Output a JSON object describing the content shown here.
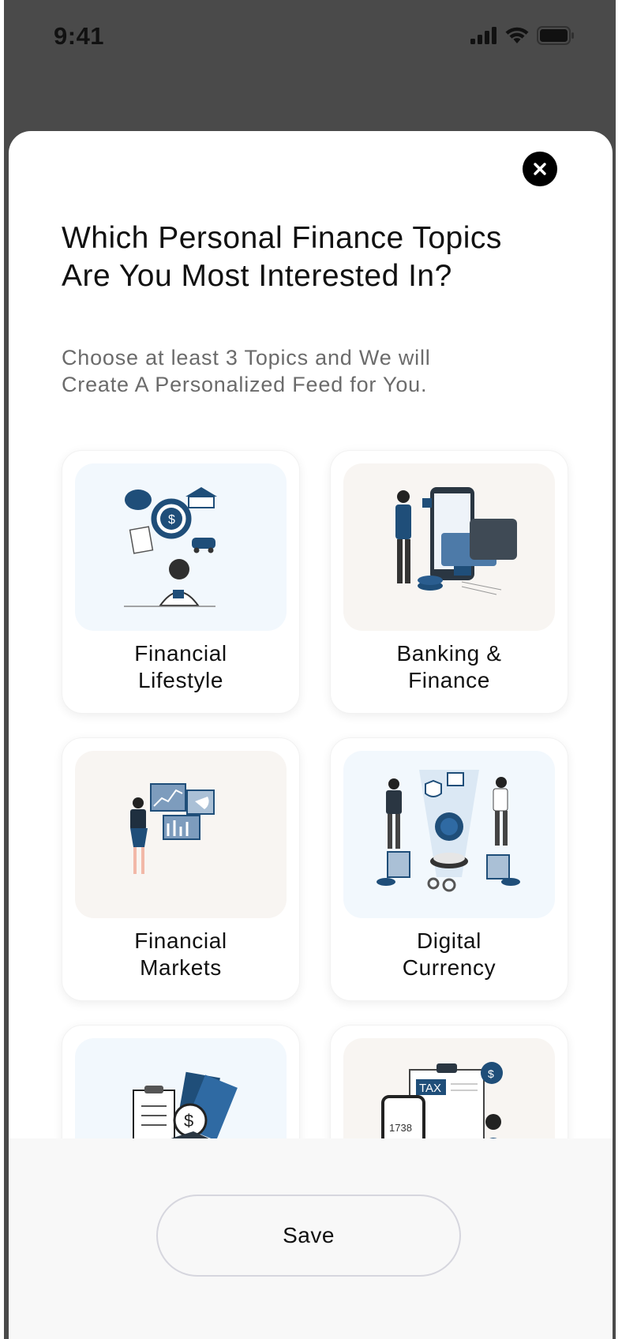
{
  "status_bar": {
    "time": "9:41"
  },
  "icons": {
    "close": "close-icon",
    "signal": "cellular-signal-icon",
    "wifi": "wifi-icon",
    "battery": "battery-icon"
  },
  "colors": {
    "backdrop": "#4a4a4a",
    "card_blue": "#f2f8fd",
    "card_cream": "#f8f5f2",
    "accent": "#1f4e79",
    "footer": "#f8f8f8"
  },
  "sheet": {
    "title": "Which Personal Finance Topics Are You Most Interested In?",
    "subtitle": "Choose at least 3 Topics and We will Create A Personalized Feed for You."
  },
  "topics": [
    {
      "label_line1": "Financial",
      "label_line2": "Lifestyle",
      "illustration": "person-budgeting-bills-savings"
    },
    {
      "label_line1": "Banking &",
      "label_line2": "Finance",
      "illustration": "person-with-phone-wallet-cards"
    },
    {
      "label_line1": "Financial",
      "label_line2": "Markets",
      "illustration": "person-presenting-charts"
    },
    {
      "label_line1": "Digital",
      "label_line2": "Currency",
      "illustration": "people-with-crypto-coin"
    },
    {
      "label_line1": "",
      "label_line2": "",
      "illustration": "clipboard-cash-dollar"
    },
    {
      "label_line1": "",
      "label_line2": "",
      "illustration": "tax-form-phone-person",
      "art_text_tax": "TAX",
      "art_text_number": "1738"
    }
  ],
  "footer": {
    "save_label": "Save"
  }
}
